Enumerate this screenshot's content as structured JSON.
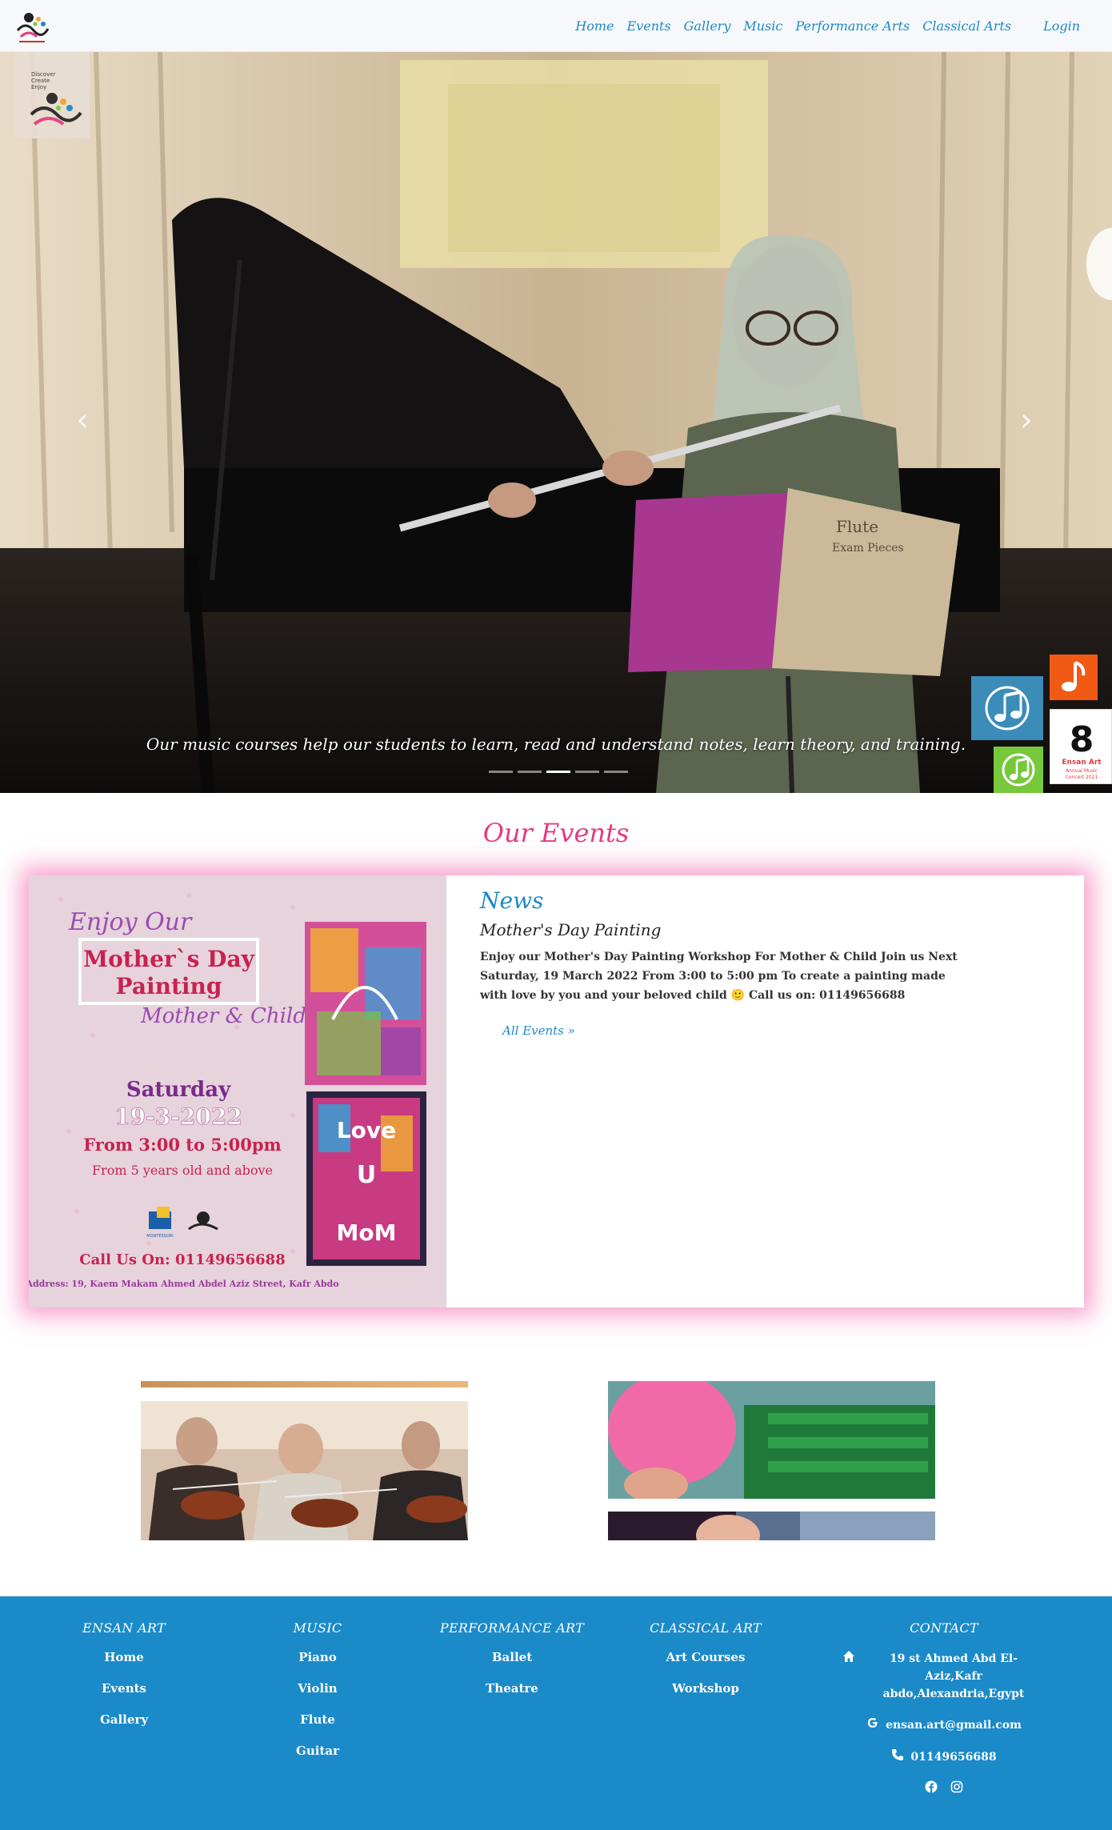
{
  "nav": {
    "links": [
      "Home",
      "Events",
      "Gallery",
      "Music",
      "Performance Arts",
      "Classical Arts"
    ],
    "login": "Login"
  },
  "hero": {
    "caption": "Our music courses help our students to learn, read and understand notes, learn theory, and training.",
    "slides_count": 5,
    "active_slide": 3,
    "prev_glyph": "‹",
    "next_glyph": "›",
    "corner_logo_text": [
      "Discover",
      "Create",
      "Enjoy"
    ],
    "music_stand_text": [
      "Flute",
      "Exam Pieces"
    ]
  },
  "floating_badges": {
    "annual_concert": [
      "8",
      "Ensan Art",
      "Annual Music",
      "Concert 2021"
    ]
  },
  "events": {
    "heading": "Our Events",
    "news_label": "News",
    "title": "Mother's Day Painting",
    "description": "Enjoy our Mother's Day Painting Workshop  For Mother & Child  Join us Next Saturday, 19 March 2022 From 3:00 to 5:00 pm  To create a painting made with love by you and your beloved child 🙂  Call us on: 01149656688",
    "all_events": "All Events",
    "poster": {
      "enjoy": "Enjoy Our",
      "line1": "Mother`s Day",
      "line2": "Painting",
      "subtitle": "Mother & Child",
      "day": "Saturday",
      "date": "19-3-2022",
      "time": "From 3:00 to 5:00pm",
      "age": "From 5  years old and above",
      "call": "Call Us On: 01149656688",
      "address": "Address: 19, Kaem Makam Ahmed Abdel Aziz Street, Kafr Abdo",
      "love_text": [
        "Love",
        "U",
        "MoM"
      ],
      "partner": "MONTESSORI"
    }
  },
  "footer": {
    "columns": [
      {
        "title": "ENSAN ART",
        "links": [
          "Home",
          "Events",
          "Gallery"
        ]
      },
      {
        "title": "MUSIC",
        "links": [
          "Piano",
          "Violin",
          "Flute",
          "Guitar"
        ]
      },
      {
        "title": "PERFORMANCE ART",
        "links": [
          "Ballet",
          "Theatre"
        ]
      },
      {
        "title": "CLASSICAL ART",
        "links": [
          "Art Courses",
          "Workshop"
        ]
      }
    ],
    "contact": {
      "title": "CONTACT",
      "address": "19 st Ahmed Abd El-Aziz,Kafr abdo,Alexandria,Egypt",
      "email": "ensan.art@gmail.com",
      "phone": "01149656688"
    }
  },
  "colors": {
    "nav_link": "#1b8ac8",
    "events_heading": "#e63a7e",
    "footer_bg": "#1b8ac8",
    "card_glow": "#f050a0"
  }
}
